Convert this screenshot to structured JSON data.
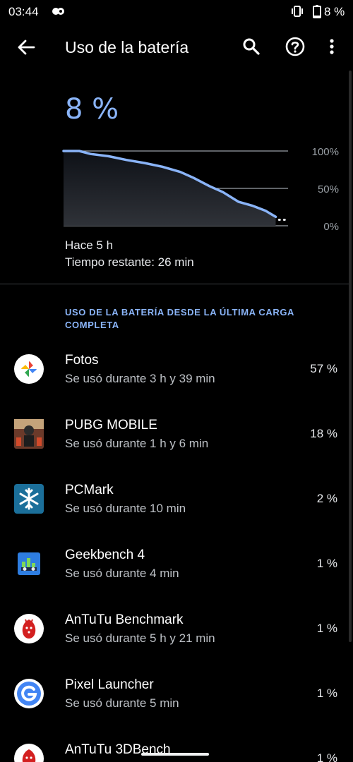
{
  "status_bar": {
    "time": "03:44",
    "battery_text": "8 %",
    "notification_icon": "dual-dot-icon",
    "vibrate_icon": "vibrate-icon",
    "battery_icon": "battery-icon"
  },
  "toolbar": {
    "title": "Uso de la batería",
    "back_icon": "arrow-back-icon",
    "search_icon": "search-icon",
    "help_icon": "help-icon",
    "more_icon": "more-vert-icon"
  },
  "battery": {
    "percent": "8 %",
    "start_label": "Hace 5 h",
    "remaining_label": "Tiempo restante: 26 min"
  },
  "chart_data": {
    "type": "area",
    "y_tick_labels": [
      "100%",
      "50%",
      "0%"
    ],
    "ylim": [
      0,
      100
    ],
    "xlim": [
      0,
      1
    ],
    "grid": true,
    "color": "#8ab4f8",
    "series": [
      {
        "x": [
          0,
          0.07,
          0.12,
          0.2,
          0.28,
          0.36,
          0.44,
          0.52,
          0.58,
          0.65,
          0.71,
          0.78,
          0.84,
          0.9,
          0.945
        ],
        "y": [
          100,
          100,
          96,
          93,
          88,
          84,
          79,
          72,
          64,
          53,
          45,
          32,
          27,
          20,
          12
        ]
      },
      {
        "x": [
          0.96,
          0.99
        ],
        "y": [
          8,
          8
        ],
        "style": "dotted"
      }
    ]
  },
  "section": {
    "title": "Uso de la batería desde la última carga completa"
  },
  "apps": [
    {
      "name": "Fotos",
      "usage": "Se usó durante 3 h y 39 min",
      "percent": "57 %",
      "icon": "google-photos-icon"
    },
    {
      "name": "PUBG MOBILE",
      "usage": "Se usó durante 1 h y 6 min",
      "percent": "18 %",
      "icon": "pubg-mobile-icon"
    },
    {
      "name": "PCMark",
      "usage": "Se usó durante 10 min",
      "percent": "2 %",
      "icon": "pcmark-icon"
    },
    {
      "name": "Geekbench 4",
      "usage": "Se usó durante 4 min",
      "percent": "1 %",
      "icon": "geekbench-icon"
    },
    {
      "name": "AnTuTu Benchmark",
      "usage": "Se usó durante 5 h y 21 min",
      "percent": "1 %",
      "icon": "antutu-icon"
    },
    {
      "name": "Pixel Launcher",
      "usage": "Se usó durante 5 min",
      "percent": "1 %",
      "icon": "pixel-launcher-icon"
    },
    {
      "name": "AnTuTu 3DBench",
      "usage": "",
      "percent": "1 %",
      "icon": "antutu-3dbench-icon"
    }
  ],
  "colors": {
    "accent": "#8ab4f8",
    "background": "#000000"
  }
}
